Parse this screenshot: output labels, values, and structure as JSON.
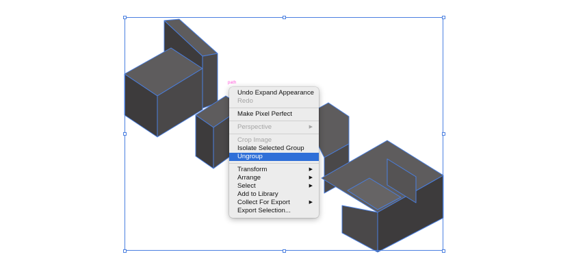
{
  "selection": {
    "anchor_label": "path"
  },
  "menu": {
    "groups": [
      [
        {
          "label": "Undo Expand Appearance",
          "disabled": false
        },
        {
          "label": "Redo",
          "disabled": true
        }
      ],
      [
        {
          "label": "Make Pixel Perfect",
          "disabled": false
        }
      ],
      [
        {
          "label": "Perspective",
          "disabled": true,
          "submenu": true
        }
      ],
      [
        {
          "label": "Crop Image",
          "disabled": true
        },
        {
          "label": "Isolate Selected Group",
          "disabled": false
        },
        {
          "label": "Ungroup",
          "disabled": false,
          "highlighted": true
        }
      ],
      [
        {
          "label": "Transform",
          "disabled": false,
          "submenu": true
        },
        {
          "label": "Arrange",
          "disabled": false,
          "submenu": true
        },
        {
          "label": "Select",
          "disabled": false,
          "submenu": true
        },
        {
          "label": "Add to Library",
          "disabled": false
        },
        {
          "label": "Collect For Export",
          "disabled": false,
          "submenu": true
        },
        {
          "label": "Export Selection...",
          "disabled": false
        }
      ]
    ]
  },
  "colors": {
    "accent": "#2f6fd8",
    "selection_blue": "#4a7fe0",
    "letter_top": "#5e5c5d",
    "letter_side": "#4a4849",
    "letter_front": "#3d3b3c"
  }
}
